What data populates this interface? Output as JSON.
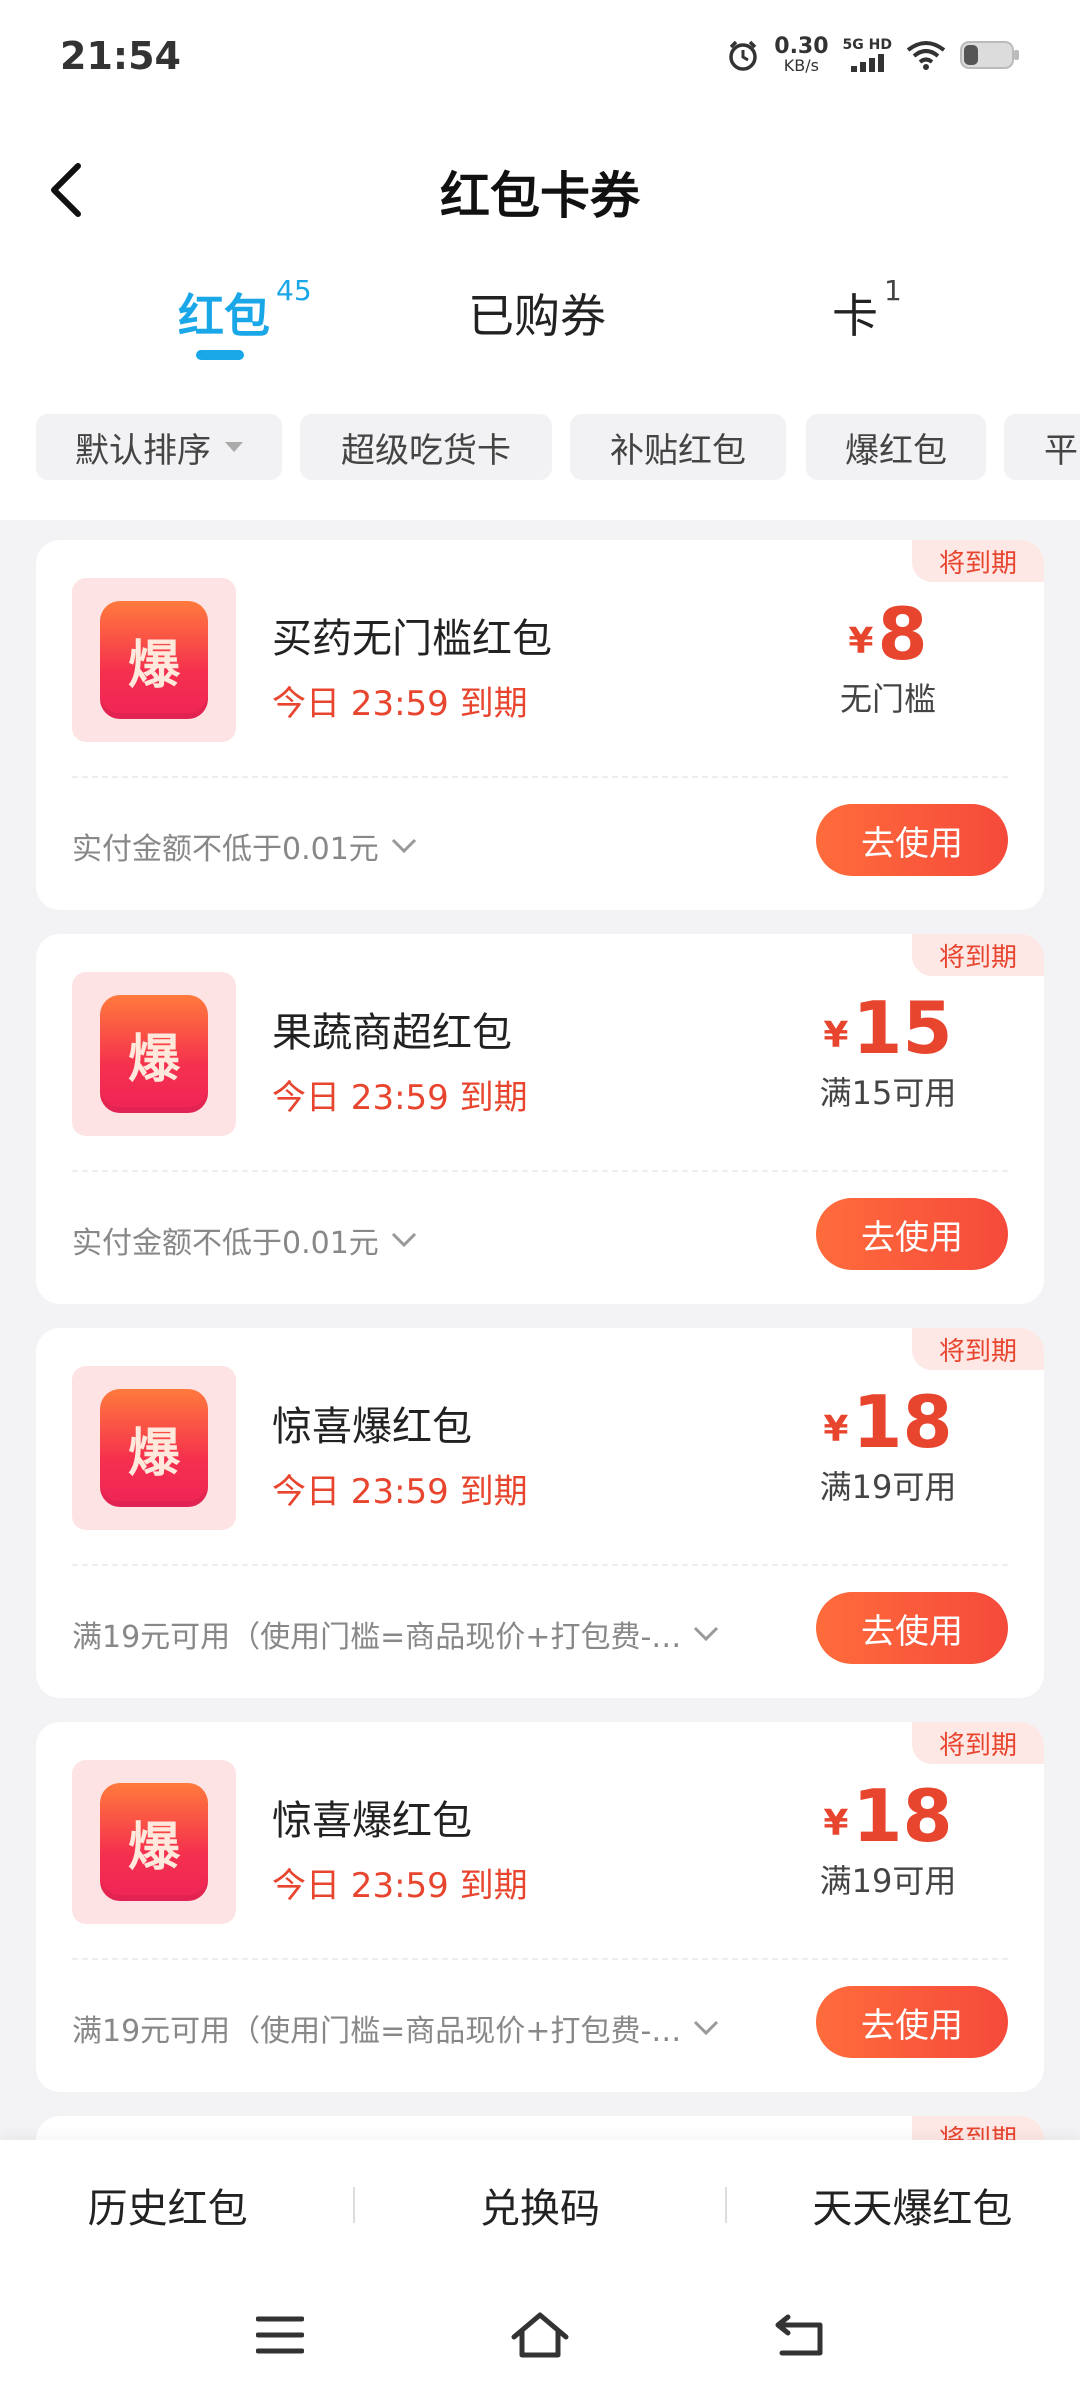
{
  "status_bar": {
    "time": "21:54",
    "speed_value": "0.30",
    "speed_unit": "KB/s",
    "network": "5G HD"
  },
  "header": {
    "title": "红包卡券"
  },
  "tabs": [
    {
      "label": "红包",
      "count": "45"
    },
    {
      "label": "已购券",
      "count": ""
    },
    {
      "label": "卡",
      "count": "1"
    }
  ],
  "filters": [
    {
      "label": "默认排序"
    },
    {
      "label": "超级吃货卡"
    },
    {
      "label": "补贴红包"
    },
    {
      "label": "爆红包"
    },
    {
      "label": "平"
    }
  ],
  "coupons": [
    {
      "badge": "将到期",
      "logo_char": "爆",
      "name": "买药无门槛红包",
      "expiry": "今日 23:59 到期",
      "currency": "¥",
      "amount": "8",
      "threshold": "无门槛",
      "rule": "实付金额不低于0.01元",
      "button": "去使用"
    },
    {
      "badge": "将到期",
      "logo_char": "爆",
      "name": "果蔬商超红包",
      "expiry": "今日 23:59 到期",
      "currency": "¥",
      "amount": "15",
      "threshold": "满15可用",
      "rule": "实付金额不低于0.01元",
      "button": "去使用"
    },
    {
      "badge": "将到期",
      "logo_char": "爆",
      "name": "惊喜爆红包",
      "expiry": "今日 23:59 到期",
      "currency": "¥",
      "amount": "18",
      "threshold": "满19可用",
      "rule": "满19元可用（使用门槛=商品现价+打包费-…",
      "button": "去使用"
    },
    {
      "badge": "将到期",
      "logo_char": "爆",
      "name": "惊喜爆红包",
      "expiry": "今日 23:59 到期",
      "currency": "¥",
      "amount": "18",
      "threshold": "满19可用",
      "rule": "满19元可用（使用门槛=商品现价+打包费-…",
      "button": "去使用"
    }
  ],
  "partial_card": {
    "badge": "将到期"
  },
  "bottom_bar": {
    "history": "历史红包",
    "redeem": "兑换码",
    "daily": "天天爆红包"
  },
  "colors": {
    "accent_blue": "#1aa7e8",
    "coupon_red": "#e8452f",
    "button_orange": "#f54a3b"
  }
}
